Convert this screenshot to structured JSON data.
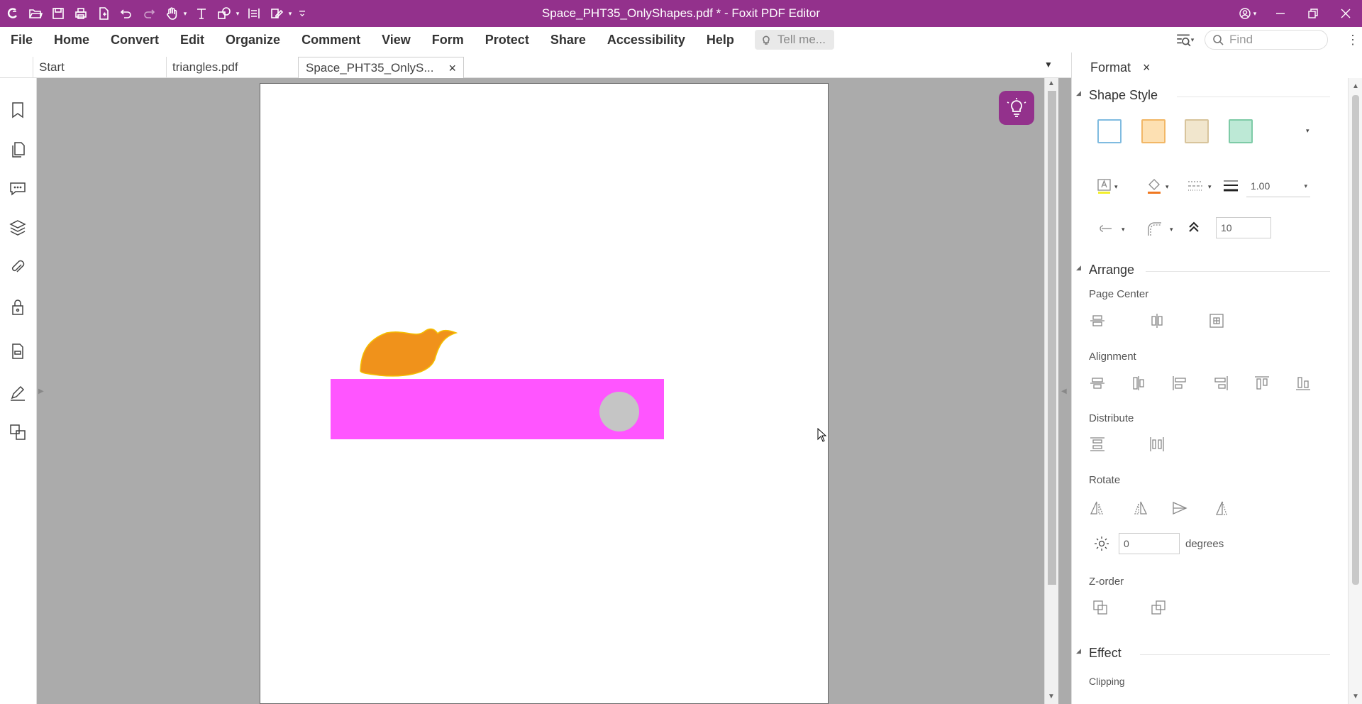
{
  "titlebar": {
    "title": "Space_PHT35_OnlyShapes.pdf * - Foxit PDF Editor",
    "quick_access": [
      "foxit-logo-icon",
      "open-icon",
      "save-icon",
      "print-icon",
      "new-icon",
      "undo-icon",
      "redo-icon",
      "hand-icon",
      "text-icon",
      "shape-icon",
      "column-icon",
      "edit-icon",
      "customize-icon"
    ]
  },
  "menu": {
    "items": [
      "File",
      "Home",
      "Convert",
      "Edit",
      "Organize",
      "Comment",
      "View",
      "Form",
      "Protect",
      "Share",
      "Accessibility",
      "Help"
    ],
    "tellme_placeholder": "Tell me...",
    "find_placeholder": "Find"
  },
  "tabs": {
    "items": [
      "Start",
      "triangles.pdf",
      "Space_PHT35_OnlyS..."
    ],
    "active_index": 2,
    "close_glyph": "×"
  },
  "panel": {
    "tab_label": "Format",
    "close_glyph": "×",
    "shape_style": {
      "title": "Shape Style",
      "swatches": [
        {
          "fill": "#ffffff",
          "border": "#7fbbe0"
        },
        {
          "fill": "#fde0b2",
          "border": "#f2b766"
        },
        {
          "fill": "#f1e6cd",
          "border": "#d8c49c"
        },
        {
          "fill": "#bde9d6",
          "border": "#7ecba7"
        }
      ],
      "line_width": "1.00",
      "opacity": "10"
    },
    "arrange": {
      "title": "Arrange",
      "page_center": "Page Center",
      "alignment": "Alignment",
      "distribute": "Distribute",
      "rotate": "Rotate",
      "rotate_value": "0",
      "rotate_unit": "degrees",
      "zorder": "Z-order"
    },
    "effect": {
      "title": "Effect",
      "clipping": "Clipping"
    }
  },
  "canvas": {
    "shapes": [
      {
        "name": "orange-freeform-shape",
        "color": "#f0921b"
      },
      {
        "name": "magenta-rectangle",
        "color": "#ff55ff"
      },
      {
        "name": "gray-circle",
        "color": "#c5c5c5"
      }
    ]
  },
  "colors": {
    "brand": "#93318c",
    "page": "#ffffff",
    "workspace": "#ababab"
  }
}
